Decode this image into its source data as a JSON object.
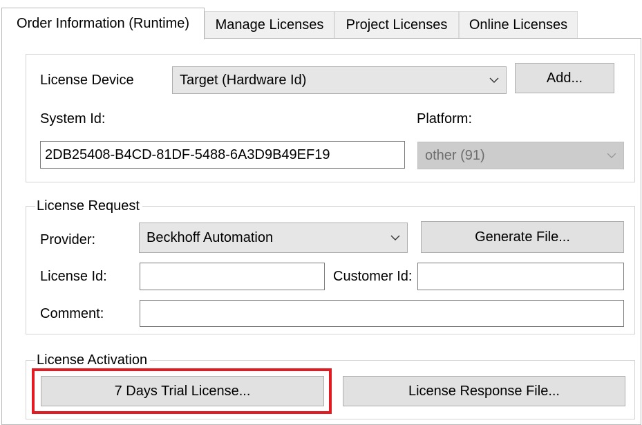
{
  "tabs": [
    {
      "label": "Order Information (Runtime)",
      "active": true
    },
    {
      "label": "Manage Licenses"
    },
    {
      "label": "Project Licenses"
    },
    {
      "label": "Online Licenses"
    }
  ],
  "device": {
    "license_device_label": "License Device",
    "license_device_value": "Target (Hardware Id)",
    "add_button": "Add...",
    "system_id_label": "System Id:",
    "system_id_value": "2DB25408-B4CD-81DF-5488-6A3D9B49EF19",
    "platform_label": "Platform:",
    "platform_value": "other (91)"
  },
  "request": {
    "legend": "License Request",
    "provider_label": "Provider:",
    "provider_value": "Beckhoff Automation",
    "generate_button": "Generate File...",
    "license_id_label": "License Id:",
    "license_id_value": "",
    "customer_id_label": "Customer Id:",
    "customer_id_value": "",
    "comment_label": "Comment:",
    "comment_value": ""
  },
  "activation": {
    "legend": "License Activation",
    "trial_button": "7 Days Trial License...",
    "response_button": "License Response File..."
  },
  "colors": {
    "highlight": "#e21b23",
    "button_bg": "#e1e1e1",
    "combo_bg": "#e6e6e6",
    "disabled_bg": "#cccccc"
  },
  "icons": {
    "dropdown": "chevron-down-icon"
  }
}
